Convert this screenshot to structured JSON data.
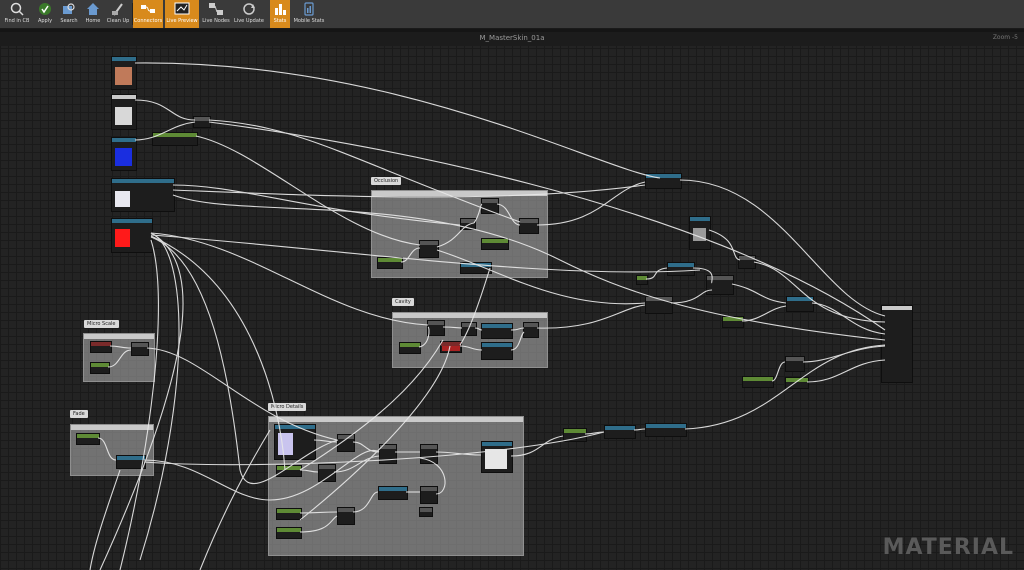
{
  "toolbar": {
    "buttons": [
      {
        "label": "Find in CB",
        "icon": "find-in-cb-icon",
        "active": false
      },
      {
        "label": "Apply",
        "icon": "apply-icon",
        "active": false
      },
      {
        "label": "Search",
        "icon": "search-icon",
        "active": false
      },
      {
        "label": "Home",
        "icon": "home-icon",
        "active": false
      },
      {
        "label": "Clean Up",
        "icon": "clean-up-icon",
        "active": false
      },
      {
        "label": "Connectors",
        "icon": "connectors-icon",
        "active": true
      },
      {
        "label": "Live Preview",
        "icon": "live-preview-icon",
        "active": true
      },
      {
        "label": "Live Nodes",
        "icon": "live-nodes-icon",
        "active": false
      },
      {
        "label": "Live Update",
        "icon": "live-update-icon",
        "active": false
      },
      {
        "label": "Stats",
        "icon": "stats-icon",
        "active": true
      },
      {
        "label": "Mobile Stats",
        "icon": "mobile-stats-icon",
        "active": false
      }
    ]
  },
  "graph": {
    "title": "M_MasterSkin_01a",
    "zoom": "Zoom -5",
    "watermark": "MATERIAL"
  },
  "comments": {
    "occlusion": "Occlusion",
    "cavity": "Cavity",
    "micro_scale": "Micro Scale",
    "fade": "Fade",
    "micro_details": "Micro Details"
  },
  "colors": {
    "accent": "#d88a1c",
    "texture_header": "#2f6d8a",
    "param_header": "#5e8a35",
    "vector_param": "#7a2a2a",
    "wire": "#e8e8e8"
  }
}
